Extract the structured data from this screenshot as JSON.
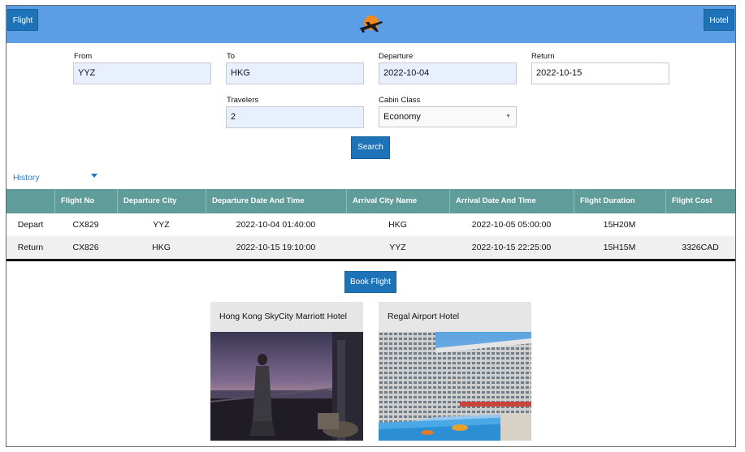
{
  "header": {
    "flight_button": "Flight",
    "hotel_button": "Hotel"
  },
  "search": {
    "from_label": "From",
    "from_value": "YYZ",
    "to_label": "To",
    "to_value": "HKG",
    "departure_label": "Departure",
    "departure_value": "2022-10-04",
    "return_label": "Return",
    "return_value": "2022-10-15",
    "travelers_label": "Travelers",
    "travelers_value": "2",
    "cabin_label": "Cabin Class",
    "cabin_value": "Economy",
    "search_button": "Search"
  },
  "history": {
    "label": "History"
  },
  "table": {
    "headers": [
      "",
      "Flight No",
      "Departure City",
      "Departure Date And Time",
      "Arrival City Name",
      "Arrival Date And Time",
      "Flight Duration",
      "Flight Cost"
    ],
    "rows": [
      [
        "Depart",
        "CX829",
        "YYZ",
        "2022-10-04 01:40:00",
        "HKG",
        "2022-10-05 05:00:00",
        "15H20M",
        ""
      ],
      [
        "Return",
        "CX826",
        "HKG",
        "2022-10-15 19:10:00",
        "YYZ",
        "2022-10-15 22:25:00",
        "15H15M",
        "3326CAD"
      ]
    ]
  },
  "book_button": "Book Flight",
  "hotels": [
    {
      "name": "Hong Kong SkyCity Marriott Hotel"
    },
    {
      "name": "Regal Airport Hotel"
    }
  ],
  "colors": {
    "header_bg": "#5c9ee6",
    "button": "#1e73b8",
    "table_header": "#5f9c9a",
    "input_bg": "#e8f0fd"
  }
}
